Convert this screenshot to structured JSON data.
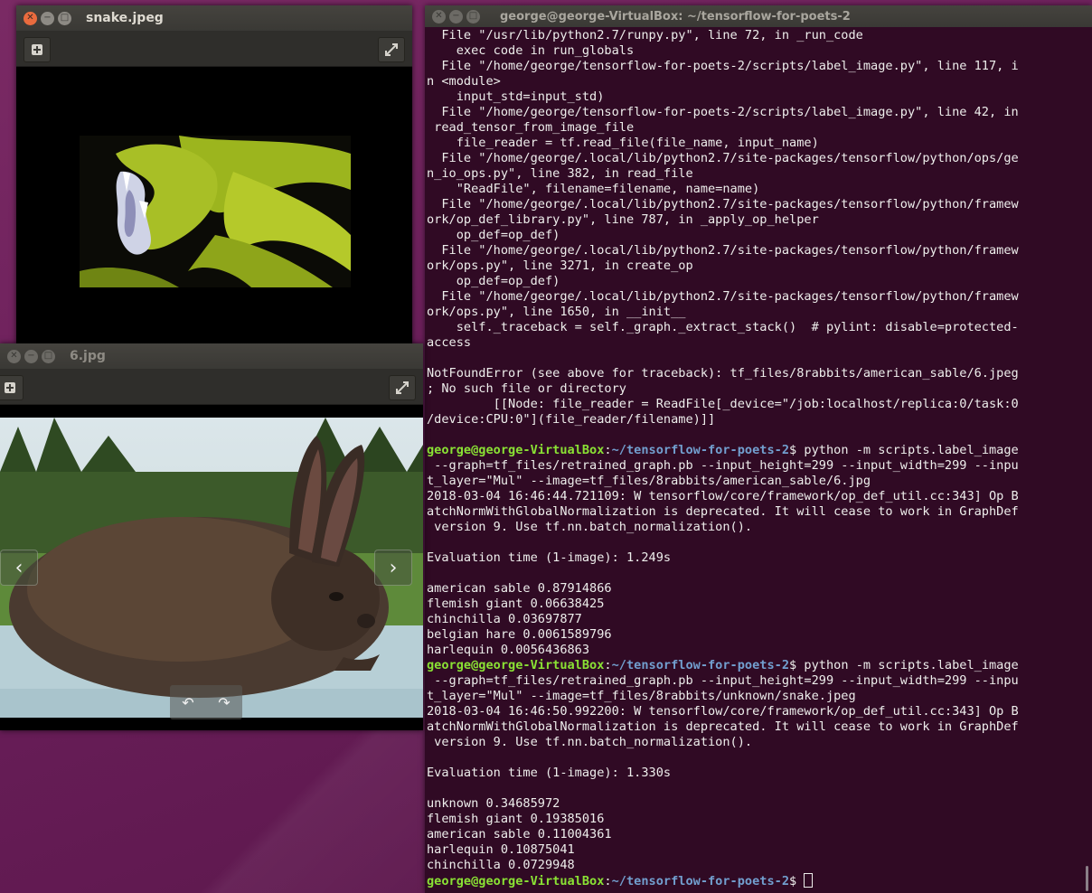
{
  "terminal": {
    "title": "george@george-VirtualBox: ~/tensorflow-for-poets-2",
    "prompt_user": "george@george-VirtualBox",
    "prompt_path": "~/tensorflow-for-poets-2",
    "lines": [
      {
        "text": "  File \"/usr/lib/python2.7/runpy.py\", line 72, in _run_code"
      },
      {
        "text": "    exec code in run_globals"
      },
      {
        "text": "  File \"/home/george/tensorflow-for-poets-2/scripts/label_image.py\", line 117, i"
      },
      {
        "text": "n <module>"
      },
      {
        "text": "    input_std=input_std)"
      },
      {
        "text": "  File \"/home/george/tensorflow-for-poets-2/scripts/label_image.py\", line 42, in"
      },
      {
        "text": " read_tensor_from_image_file"
      },
      {
        "text": "    file_reader = tf.read_file(file_name, input_name)"
      },
      {
        "text": "  File \"/home/george/.local/lib/python2.7/site-packages/tensorflow/python/ops/ge"
      },
      {
        "text": "n_io_ops.py\", line 382, in read_file"
      },
      {
        "text": "    \"ReadFile\", filename=filename, name=name)"
      },
      {
        "text": "  File \"/home/george/.local/lib/python2.7/site-packages/tensorflow/python/framew"
      },
      {
        "text": "ork/op_def_library.py\", line 787, in _apply_op_helper"
      },
      {
        "text": "    op_def=op_def)"
      },
      {
        "text": "  File \"/home/george/.local/lib/python2.7/site-packages/tensorflow/python/framew"
      },
      {
        "text": "ork/ops.py\", line 3271, in create_op"
      },
      {
        "text": "    op_def=op_def)"
      },
      {
        "text": "  File \"/home/george/.local/lib/python2.7/site-packages/tensorflow/python/framew"
      },
      {
        "text": "ork/ops.py\", line 1650, in __init__"
      },
      {
        "text": "    self._traceback = self._graph._extract_stack()  # pylint: disable=protected-"
      },
      {
        "text": "access"
      },
      {
        "text": ""
      },
      {
        "text": "NotFoundError (see above for traceback): tf_files/8rabbits/american_sable/6.jpeg"
      },
      {
        "text": "; No such file or directory"
      },
      {
        "text": "         [[Node: file_reader = ReadFile[_device=\"/job:localhost/replica:0/task:0"
      },
      {
        "text": "/device:CPU:0\"](file_reader/filename)]]"
      },
      {
        "text": ""
      },
      {
        "prompt": true,
        "text": "$ python -m scripts.label_image"
      },
      {
        "text": " --graph=tf_files/retrained_graph.pb --input_height=299 --input_width=299 --inpu"
      },
      {
        "text": "t_layer=\"Mul\" --image=tf_files/8rabbits/american_sable/6.jpg"
      },
      {
        "text": "2018-03-04 16:46:44.721109: W tensorflow/core/framework/op_def_util.cc:343] Op B"
      },
      {
        "text": "atchNormWithGlobalNormalization is deprecated. It will cease to work in GraphDef"
      },
      {
        "text": " version 9. Use tf.nn.batch_normalization()."
      },
      {
        "text": ""
      },
      {
        "text": "Evaluation time (1-image): 1.249s"
      },
      {
        "text": ""
      },
      {
        "text": "american sable 0.87914866"
      },
      {
        "text": "flemish giant 0.06638425"
      },
      {
        "text": "chinchilla 0.03697877"
      },
      {
        "text": "belgian hare 0.0061589796"
      },
      {
        "text": "harlequin 0.0056436863"
      },
      {
        "prompt": true,
        "text": "$ python -m scripts.label_image"
      },
      {
        "text": " --graph=tf_files/retrained_graph.pb --input_height=299 --input_width=299 --inpu"
      },
      {
        "text": "t_layer=\"Mul\" --image=tf_files/8rabbits/unknown/snake.jpeg"
      },
      {
        "text": "2018-03-04 16:46:50.992200: W tensorflow/core/framework/op_def_util.cc:343] Op B"
      },
      {
        "text": "atchNormWithGlobalNormalization is deprecated. It will cease to work in GraphDef"
      },
      {
        "text": " version 9. Use tf.nn.batch_normalization()."
      },
      {
        "text": ""
      },
      {
        "text": "Evaluation time (1-image): 1.330s"
      },
      {
        "text": ""
      },
      {
        "text": "unknown 0.34685972"
      },
      {
        "text": "flemish giant 0.19385016"
      },
      {
        "text": "american sable 0.11004361"
      },
      {
        "text": "harlequin 0.10875041"
      },
      {
        "text": "chinchilla 0.0729948"
      },
      {
        "prompt": true,
        "text": "$ ",
        "cursor": true
      }
    ]
  },
  "snake_viewer": {
    "title": "snake.jpeg",
    "add_icon": "plus-icon",
    "fullscreen_icon": "expand-icon"
  },
  "rabbit_viewer": {
    "title": "6.jpg",
    "add_icon": "plus-icon",
    "fullscreen_icon": "expand-icon",
    "prev_glyph": "‹",
    "next_glyph": "›",
    "rotate_left_glyph": "↶",
    "rotate_right_glyph": "↷"
  },
  "colors": {
    "terminal_bg": "#300a24",
    "prompt_user": "#8ae234",
    "prompt_path": "#729fcf",
    "close_button": "#e96b3e"
  }
}
